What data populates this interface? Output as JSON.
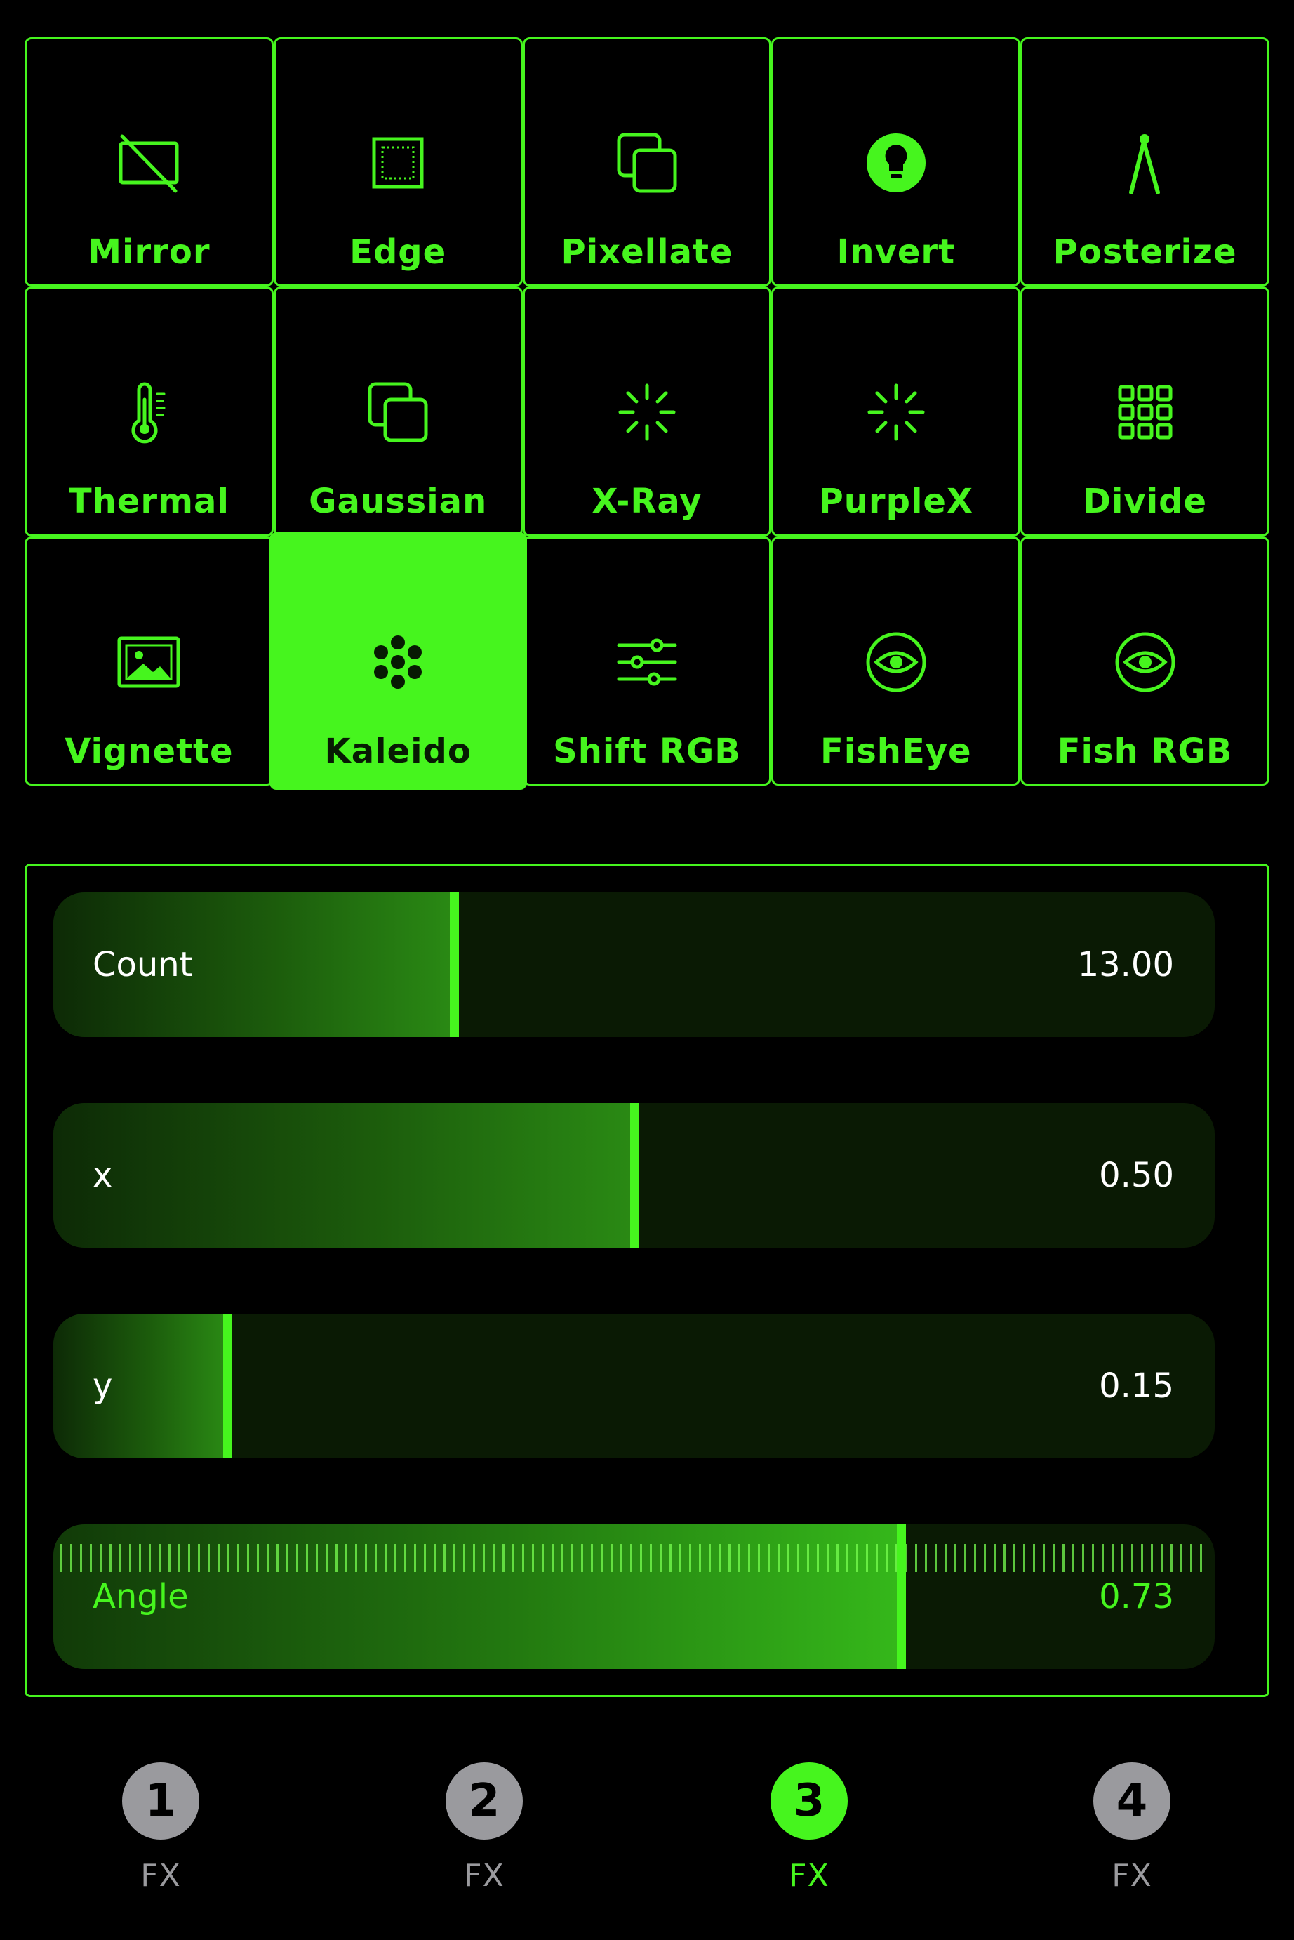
{
  "colors": {
    "accent": "#46f51e",
    "background": "#000000",
    "slider_track": "#0a1a04",
    "inactive_tab": "#9a9a9e"
  },
  "effects": [
    {
      "label": "Mirror",
      "icon": "mirror-icon"
    },
    {
      "label": "Edge",
      "icon": "edge-icon"
    },
    {
      "label": "Pixellate",
      "icon": "pixellate-icon"
    },
    {
      "label": "Invert",
      "icon": "invert-icon"
    },
    {
      "label": "Posterize",
      "icon": "posterize-icon"
    },
    {
      "label": "Thermal",
      "icon": "thermal-icon"
    },
    {
      "label": "Gaussian",
      "icon": "gaussian-icon"
    },
    {
      "label": "X-Ray",
      "icon": "xray-icon"
    },
    {
      "label": "PurpleX",
      "icon": "purplex-icon"
    },
    {
      "label": "Divide",
      "icon": "divide-icon"
    },
    {
      "label": "Vignette",
      "icon": "vignette-icon"
    },
    {
      "label": "Kaleido",
      "icon": "kaleido-icon",
      "selected": true
    },
    {
      "label": "Shift RGB",
      "icon": "shift-rgb-icon"
    },
    {
      "label": "FishEye",
      "icon": "fisheye-icon"
    },
    {
      "label": "Fish RGB",
      "icon": "fish-rgb-icon"
    }
  ],
  "sliders": [
    {
      "name": "Count",
      "value": "13.00",
      "fill": 0.345
    },
    {
      "name": "x",
      "value": "0.50",
      "fill": 0.5
    },
    {
      "name": "y",
      "value": "0.15",
      "fill": 0.15
    },
    {
      "name": "Angle",
      "value": "0.73",
      "fill": 0.73
    }
  ],
  "tabs": [
    {
      "number": "1",
      "label": "FX"
    },
    {
      "number": "2",
      "label": "FX"
    },
    {
      "number": "3",
      "label": "FX",
      "active": true
    },
    {
      "number": "4",
      "label": "FX"
    }
  ]
}
